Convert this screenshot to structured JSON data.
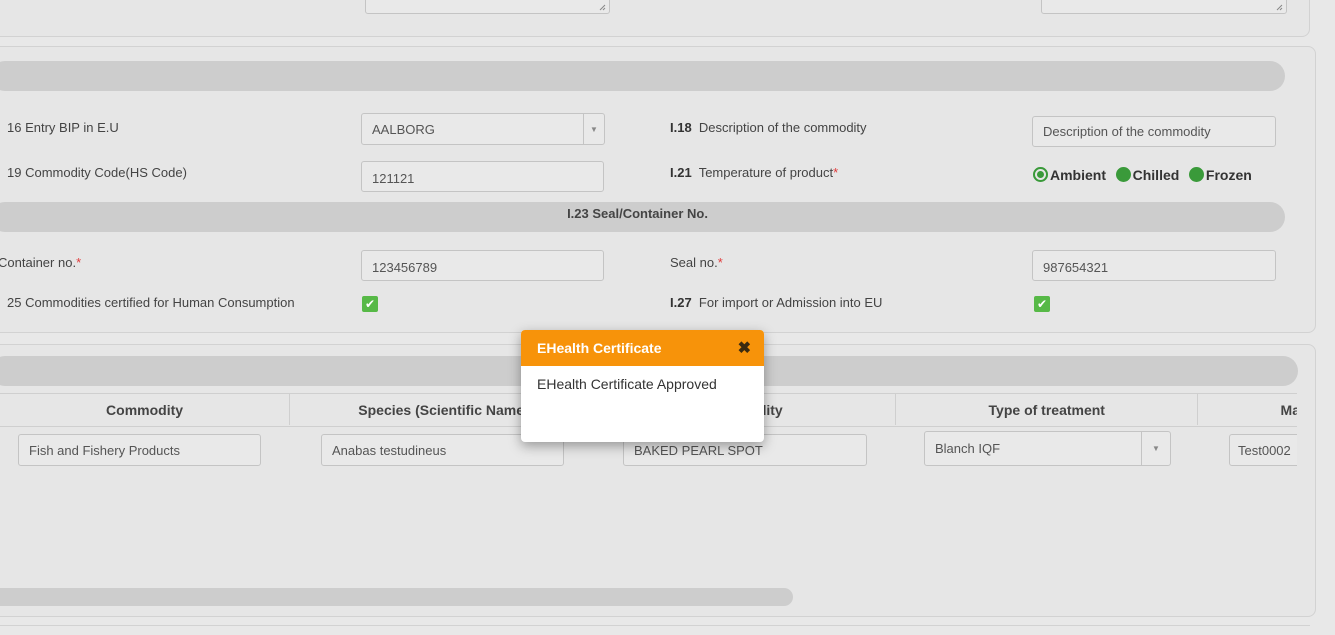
{
  "top_textareas": [
    "",
    ""
  ],
  "section2": {
    "entry_bip_label": "16  Entry BIP in E.U",
    "entry_bip_value": "AALBORG",
    "desc_num": "I.18",
    "desc_label": "Description of the commodity",
    "desc_placeholder": "Description of the commodity",
    "hs_label": "19  Commodity Code(HS Code)",
    "hs_value": "121121",
    "temp_num": "I.21",
    "temp_label": "Temperature of product",
    "required_mark": "*",
    "temp_options": [
      "Ambient",
      "Chilled",
      "Frozen"
    ],
    "temp_selected": "Ambient",
    "seal_header": "I.23 Seal/Container No.",
    "container_label": "Container no.",
    "container_value": "123456789",
    "seal_label": "Seal no.",
    "seal_value": "987654321",
    "human_label": "25  Commodities certified for Human Consumption",
    "human_checked": true,
    "import_num": "I.27",
    "import_label": "For import or Admission into EU",
    "import_checked": true
  },
  "table": {
    "headers": [
      "Commodity",
      "Species (Scientific Name",
      "Commodity",
      "Type of treatment",
      "Ma"
    ],
    "row": {
      "commodity": "Fish and Fishery Products",
      "species": "Anabas testudineus",
      "commodity_name": "BAKED PEARL SPOT",
      "treatment": "Blanch IQF",
      "manufacturer": "Test0002"
    }
  },
  "modal": {
    "title": "EHealth Certificate",
    "message": "EHealth Certificate Approved",
    "close_icon": "close-icon",
    "accent_color": "#f7930a"
  },
  "colors": {
    "check_green": "#57b947",
    "radio_green": "#3a9a3a",
    "required_red": "#e03b3b"
  }
}
